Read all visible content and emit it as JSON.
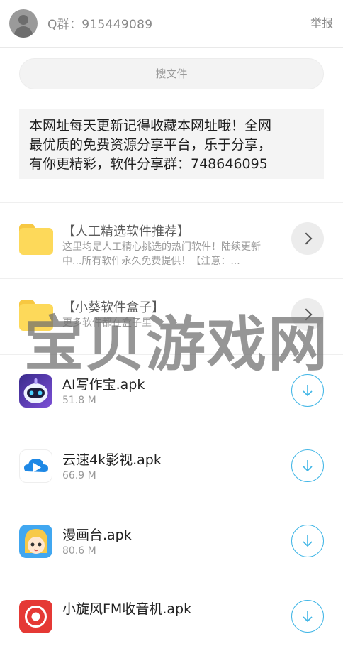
{
  "header": {
    "qq_group": "Q群：915449089",
    "report_label": "举报"
  },
  "search": {
    "placeholder": "搜文件"
  },
  "notice": {
    "lines": [
      "本网址每天更新记得收藏本网址哦！全网",
      "最优质的免费资源分享平台，乐于分享，",
      "有你更精彩，软件分享群：748646095"
    ]
  },
  "folders": [
    {
      "title": "【人工精选软件推荐】",
      "desc_lines": [
        "这里均是人工精心挑选的热门软件！陆续更新",
        "中...所有软件永久免费提供！【注意：..."
      ]
    },
    {
      "title": "【小葵软件盒子】",
      "desc_lines": [
        "更多软件都在盒子里"
      ]
    }
  ],
  "files": [
    {
      "name": "AI写作宝.apk",
      "size": "51.8 M",
      "icon": "robot-app-icon"
    },
    {
      "name": "云速4k影视.apk",
      "size": "66.9 M",
      "icon": "cloud-play-app-icon"
    },
    {
      "name": "漫画台.apk",
      "size": "80.6 M",
      "icon": "anime-girl-app-icon"
    },
    {
      "name": "小旋风FM收音机.apk",
      "size": "",
      "icon": "radio-app-icon"
    }
  ],
  "watermark": "宝贝游戏网",
  "colors": {
    "accent": "#41b6e6",
    "folder": "#fdd95a"
  }
}
